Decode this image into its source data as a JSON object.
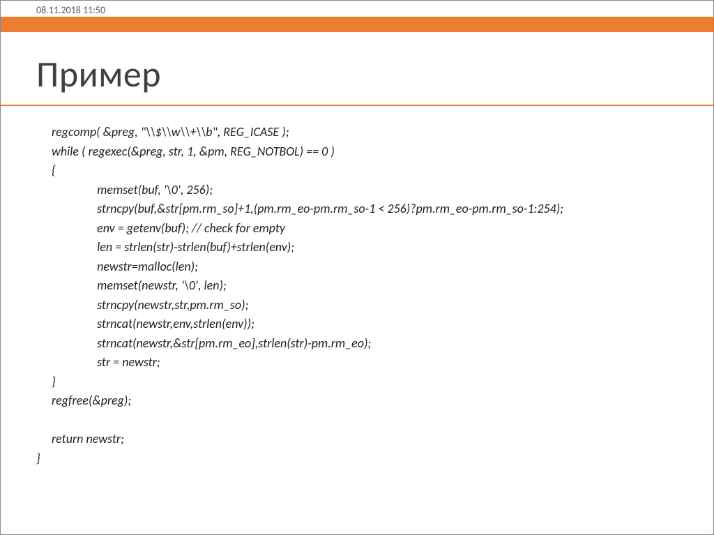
{
  "header": {
    "timestamp": "08.11.2018 11:50"
  },
  "slide": {
    "title": "Пример"
  },
  "code": {
    "lines": [
      "regcomp( &preg, \"\\\\$\\\\w\\\\+\\\\b\", REG_ICASE );",
      "while ( regexec(&preg, str, 1, &pm, REG_NOTBOL) == 0 )",
      "{",
      "                memset(buf, '\\0', 256);",
      "                strncpy(buf,&str[pm.rm_so]+1,(pm.rm_eo-pm.rm_so-1 < 256)?pm.rm_eo-pm.rm_so-1:254);",
      "                env = getenv(buf); // check for empty",
      "                len = strlen(str)-strlen(buf)+strlen(env);",
      "                newstr=malloc(len);",
      "                memset(newstr, '\\0', len);",
      "                strncpy(newstr,str,pm.rm_so);",
      "                strncat(newstr,env,strlen(env));",
      "                strncat(newstr,&str[pm.rm_eo],strlen(str)-pm.rm_eo);",
      "                str = newstr;",
      "}",
      "regfree(&preg);",
      "",
      "return newstr;"
    ],
    "closing_brace": "}"
  }
}
